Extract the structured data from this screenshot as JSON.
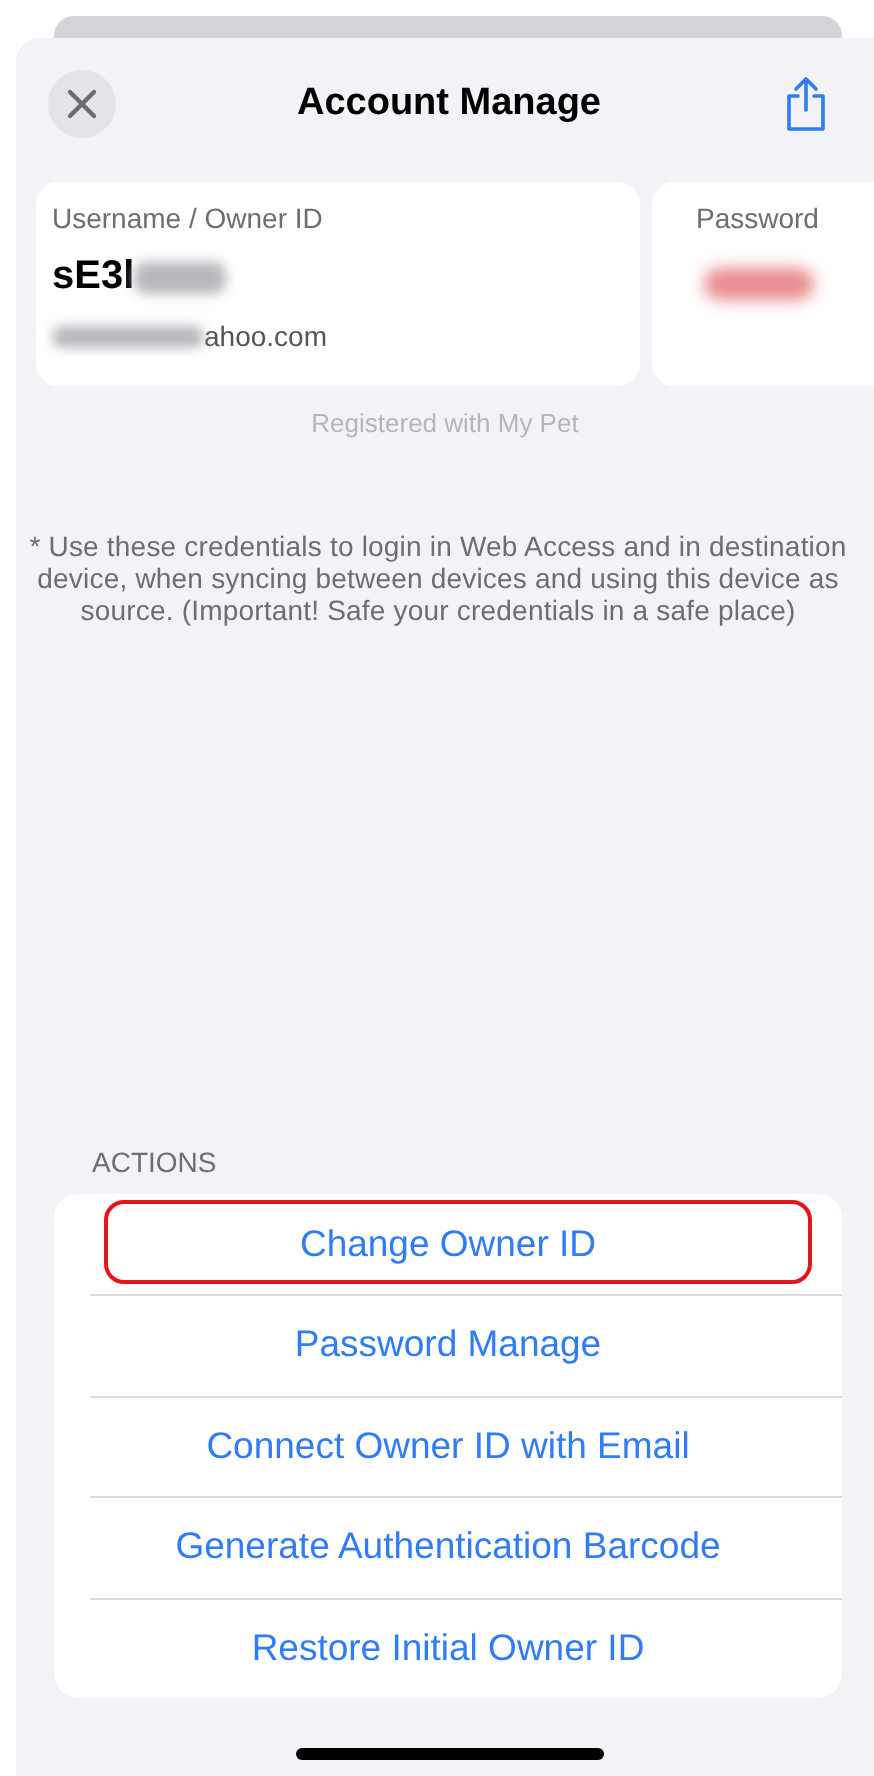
{
  "header": {
    "title": "Account Manage"
  },
  "credentials": {
    "username_label": "Username / Owner ID",
    "username": "sE3l",
    "email": "ahoo.com",
    "password_label": "Password"
  },
  "registered_note": "Registered with My Pet",
  "info_note": "* Use these credentials to login in Web Access and in destination device, when syncing between devices and using this device as source. (Important! Safe your credentials in a safe place)",
  "actions": {
    "title": "ACTIONS",
    "items": [
      {
        "label": "Change Owner ID",
        "highlighted": true
      },
      {
        "label": "Password Manage",
        "highlighted": false
      },
      {
        "label": "Connect Owner ID with Email",
        "highlighted": false
      },
      {
        "label": "Generate Authentication Barcode",
        "highlighted": false
      },
      {
        "label": "Restore Initial Owner ID",
        "highlighted": false
      }
    ]
  }
}
